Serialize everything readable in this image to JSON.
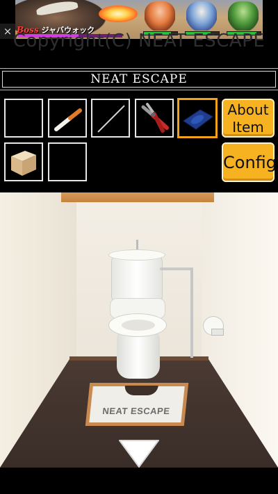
{
  "ad": {
    "close_label": "×",
    "boss_tag": "Boss",
    "boss_name": "ジャバウォック",
    "boss_hp": 0.58,
    "party_hp": [
      0.82,
      0.75,
      0.88
    ]
  },
  "copyright": "Copyright(C) NEAT ESCAPE",
  "title": "NEAT ESCAPE",
  "inventory": {
    "slots": [
      {
        "item": "empty"
      },
      {
        "item": "cigarette"
      },
      {
        "item": "wire"
      },
      {
        "item": "pliers"
      },
      {
        "item": "blue-card",
        "selected": true
      },
      {
        "item": "wooden-cube"
      },
      {
        "item": "empty"
      }
    ],
    "about_item_label": "About Item",
    "about_line1": "About",
    "about_line2": "Item",
    "config_label": "Config"
  },
  "scene": {
    "mat_text": "NEAT ESCAPE",
    "nav": "down-arrow"
  },
  "colors": {
    "accent": "#f6b221",
    "selected_border": "#f2a21b",
    "background": "#000000"
  }
}
